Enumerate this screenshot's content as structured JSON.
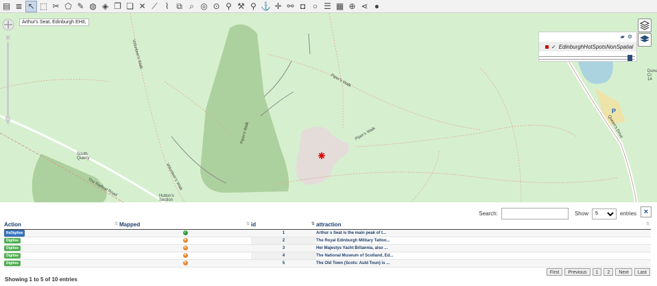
{
  "toolbar": {
    "tools": [
      "layers-icon",
      "stack-icon",
      "select-arrow-icon",
      "select-box-icon",
      "split-icon",
      "polygon-icon",
      "polygon-edit-icon",
      "globe-icon",
      "shape-icon",
      "copy-icon",
      "copy-stack-icon",
      "delete-icon",
      "ruler-icon",
      "cut-icon",
      "merge-icon",
      "zoom-feature-icon",
      "target-icon",
      "circle-dot-icon",
      "pin-icon",
      "wrench-icon",
      "search-icon",
      "anchor-icon",
      "crosshair-icon",
      "link-icon",
      "camera-icon",
      "circle-icon",
      "list-icon",
      "table-icon",
      "globe-grid-icon",
      "share-icon",
      "chat-pin-icon"
    ]
  },
  "map": {
    "tooltip": "Arthur's Seat, Edinburgh EH8,",
    "labels": {
      "volunteers_walk_top": "Volunteer's Walk",
      "volunteers_walk_bottom": "Volunteer's Walk",
      "pipers_walk_top": "Piper's Walk",
      "pipers_walk_mid": "Piper's Walk",
      "pipers_walk_right": "Piper's Walk",
      "south_quarry": "South\nQuarry",
      "radical_road": "The Radical Road",
      "huttons_section": "Hutton's\nSection",
      "queens_drive": "Queen's Drive",
      "duns": "Duns\nCr\n14"
    },
    "parking": "P",
    "layer_panel": {
      "layer_name": "EdinburghHotSpotsNonSpatial",
      "checked": true,
      "color": "#cc0000"
    }
  },
  "table": {
    "search_label": "Search:",
    "search_value": "",
    "show_label": "Show",
    "show_value": "5",
    "entries_label": "entries",
    "close": "×",
    "columns": [
      "Action",
      "Mapped",
      "id",
      "attraction"
    ],
    "rows": [
      {
        "action": "ReDigitise",
        "mapped": "yes",
        "id": "1",
        "attraction": "Arthur s Seat is the main peak of t..."
      },
      {
        "action": "Digitise",
        "mapped": "no",
        "id": "2",
        "attraction": "The Royal Edinburgh Military Tattoo..."
      },
      {
        "action": "Digitise",
        "mapped": "no",
        "id": "3",
        "attraction": "Her Majestys Yacht Britannia, also ..."
      },
      {
        "action": "Digitise",
        "mapped": "no",
        "id": "4",
        "attraction": "The National Museum of Scotland, Ed..."
      },
      {
        "action": "Digitise",
        "mapped": "no",
        "id": "5",
        "attraction": "The Old Town (Scots: Auld Toun) is ..."
      }
    ],
    "info": "Showing 1 to 5 of 10 entries",
    "pager": [
      "First",
      "Previous",
      "1",
      "2",
      "Next",
      "Last"
    ]
  }
}
